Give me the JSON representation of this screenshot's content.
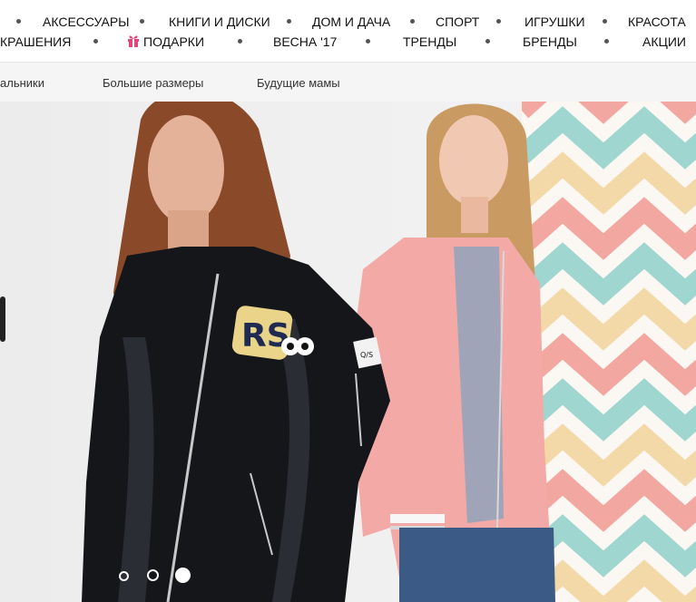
{
  "top_nav": {
    "row1": [
      "АКСЕССУАРЫ",
      "КНИГИ И ДИСКИ",
      "ДОМ И ДАЧА",
      "СПОРТ",
      "ИГРУШКИ",
      "КРАСОТА"
    ],
    "row2": [
      "КРАШЕНИЯ",
      "ПОДАРКИ",
      "ВЕСНА '17",
      "ТРЕНДЫ",
      "БРЕНДЫ",
      "АКЦИИ"
    ],
    "gift_icon": "gift-icon",
    "gift_color": "#e0457b"
  },
  "sub_nav": [
    "альники",
    "Большие размеры",
    "Будущие мамы"
  ],
  "banner": {
    "patch_text": "RS",
    "badge_text": "Q/S",
    "pager": {
      "count": 3,
      "active": 3
    }
  },
  "colors": {
    "nav_dot": "#555555",
    "subnav_bg": "#f5f5f5",
    "chevron": [
      "#f2a7a0",
      "#9fd6cf",
      "#f4d9a8"
    ]
  }
}
